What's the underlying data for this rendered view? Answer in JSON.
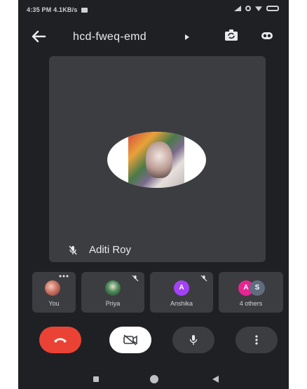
{
  "status_bar": {
    "time_text": "4:35 PM",
    "network_speed": "4.1KB/s"
  },
  "top_bar": {
    "meeting_code": "hcd-fweq-emd"
  },
  "main_tile": {
    "participant_name": "Aditi Roy"
  },
  "participants": [
    {
      "label": "You"
    },
    {
      "label": "Priya"
    },
    {
      "label": "Anshika",
      "initial": "A"
    },
    {
      "label": "4 others",
      "initials": [
        "A",
        "S"
      ]
    }
  ],
  "colors": {
    "background": "#1f2024",
    "tile": "#3c3d40",
    "end_call": "#ea4335",
    "avatar_purple": "#a142f4",
    "avatar_pink": "#e52592",
    "avatar_slate": "#5f6d7e"
  },
  "icons": {
    "back": "arrow-left-icon",
    "switch_camera": "switch-camera-icon",
    "audio": "speaker-icon",
    "mic_off": "mic-off-icon",
    "end_call": "phone-hangup-icon",
    "camera_off": "video-off-icon",
    "mic": "mic-icon",
    "more": "more-vert-icon"
  }
}
